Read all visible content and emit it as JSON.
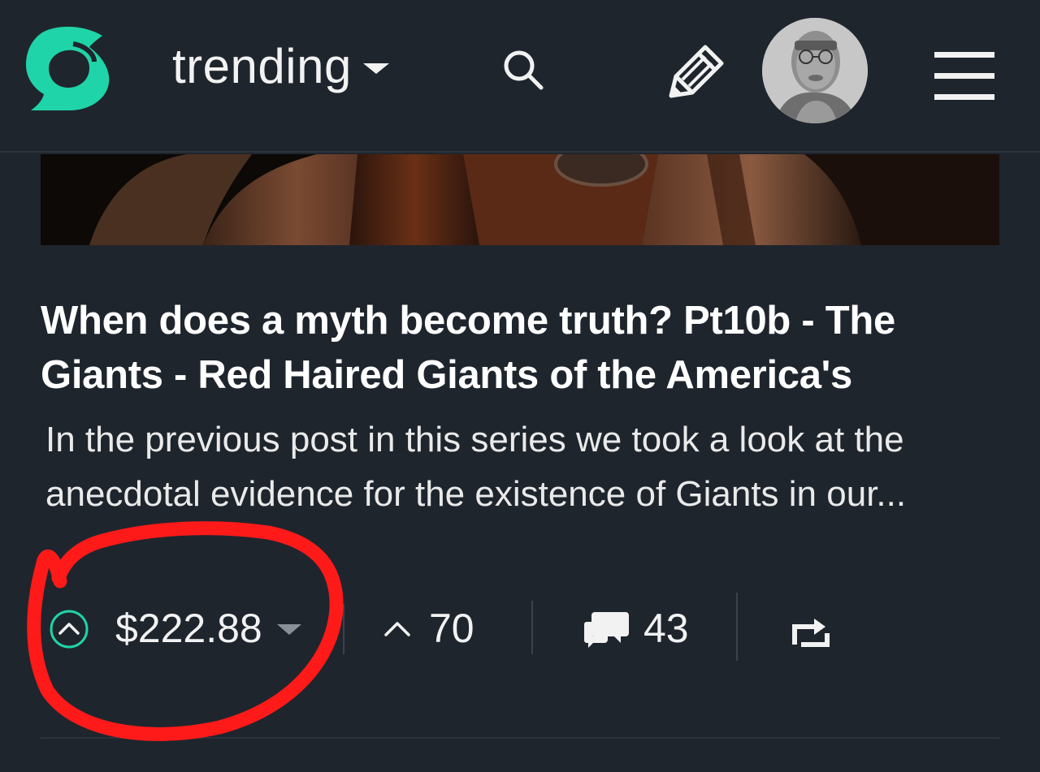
{
  "header": {
    "logo_icon": "steemit-logo-icon",
    "sort_label": "trending",
    "search_icon": "search-icon",
    "compose_icon": "pencil-icon",
    "avatar_icon": "user-avatar",
    "menu_icon": "hamburger-menu-icon"
  },
  "post": {
    "image_alt": "post-thumbnail",
    "title": "When does a myth become truth? Pt10b - The Giants - Red Haired Giants of the America's",
    "summary": "In the previous post in this series we took a look at the anecdotal evidence for the existence of Giants in our..."
  },
  "footer": {
    "payout": "$222.88",
    "votes": "70",
    "comments": "43",
    "reblog_icon": "reblog-icon"
  },
  "colors": {
    "background": "#1f252d",
    "brand": "#1fd4a8",
    "annotation": "#ff1a1a"
  }
}
